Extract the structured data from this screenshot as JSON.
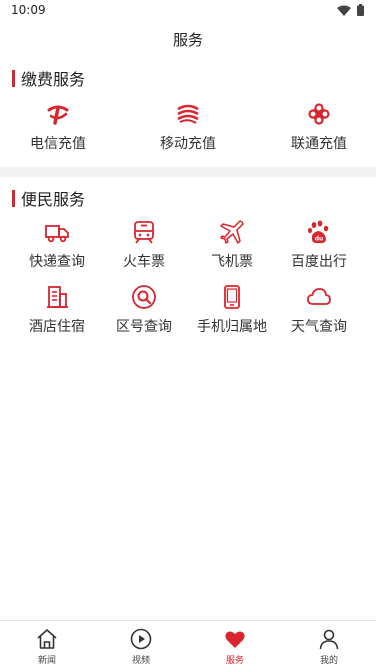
{
  "status": {
    "time": "10:09"
  },
  "header": {
    "title": "服务"
  },
  "payment": {
    "title": "缴费服务",
    "items": [
      {
        "label": "电信充值",
        "icon": "telecom-logo-icon"
      },
      {
        "label": "移动充值",
        "icon": "mobile-logo-icon"
      },
      {
        "label": "联通充值",
        "icon": "unicom-logo-icon"
      }
    ]
  },
  "convenience": {
    "title": "便民服务",
    "items": [
      {
        "label": "快递查询",
        "icon": "truck-icon"
      },
      {
        "label": "火车票",
        "icon": "train-icon"
      },
      {
        "label": "飞机票",
        "icon": "airplane-icon"
      },
      {
        "label": "百度出行",
        "icon": "baidu-paw-icon"
      },
      {
        "label": "酒店住宿",
        "icon": "building-icon"
      },
      {
        "label": "区号查询",
        "icon": "search-circle-icon"
      },
      {
        "label": "手机归属地",
        "icon": "phone-icon"
      },
      {
        "label": "天气查询",
        "icon": "cloud-icon"
      }
    ]
  },
  "nav": {
    "items": [
      {
        "label": "新闻",
        "icon": "home-icon"
      },
      {
        "label": "视频",
        "icon": "play-icon"
      },
      {
        "label": "服务",
        "icon": "heart-icon",
        "active": true
      },
      {
        "label": "我的",
        "icon": "user-icon"
      }
    ]
  },
  "colors": {
    "accent": "#d9252e",
    "divider": "#f2f2f2"
  }
}
